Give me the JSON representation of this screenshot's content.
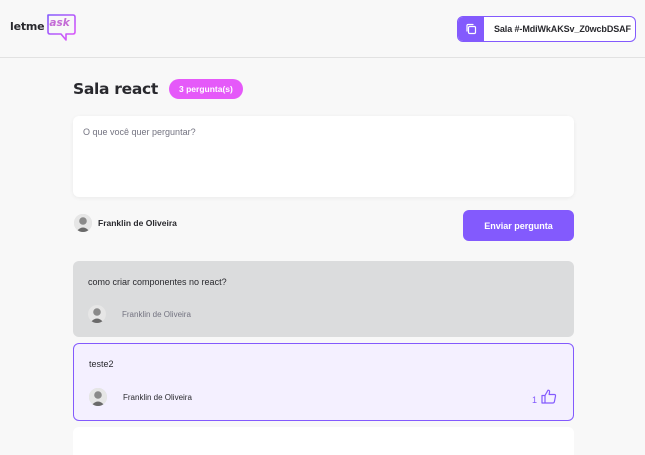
{
  "header": {
    "logo_text": "letme",
    "logo_accent": "ask",
    "room_code_label": "Sala #-MdiWkAKSv_Z0wcbDSAF",
    "copy_icon": "copy-icon"
  },
  "room": {
    "title": "Sala react",
    "question_count": "3 pergunta(s)"
  },
  "form": {
    "placeholder": "O que você quer perguntar?",
    "user_name": "Franklin de Oliveira",
    "send_label": "Enviar pergunta"
  },
  "questions": [
    {
      "content": "como criar componentes no react?",
      "author": "Franklin de Oliveira",
      "state": "answered"
    },
    {
      "content": "teste2",
      "author": "Franklin de Oliveira",
      "state": "highlighted",
      "likes": "1"
    }
  ],
  "colors": {
    "accent": "#835afd",
    "badge": "#e559f9",
    "answered_bg": "#dbdcdd",
    "highlighted_bg": "#f4f0ff"
  }
}
